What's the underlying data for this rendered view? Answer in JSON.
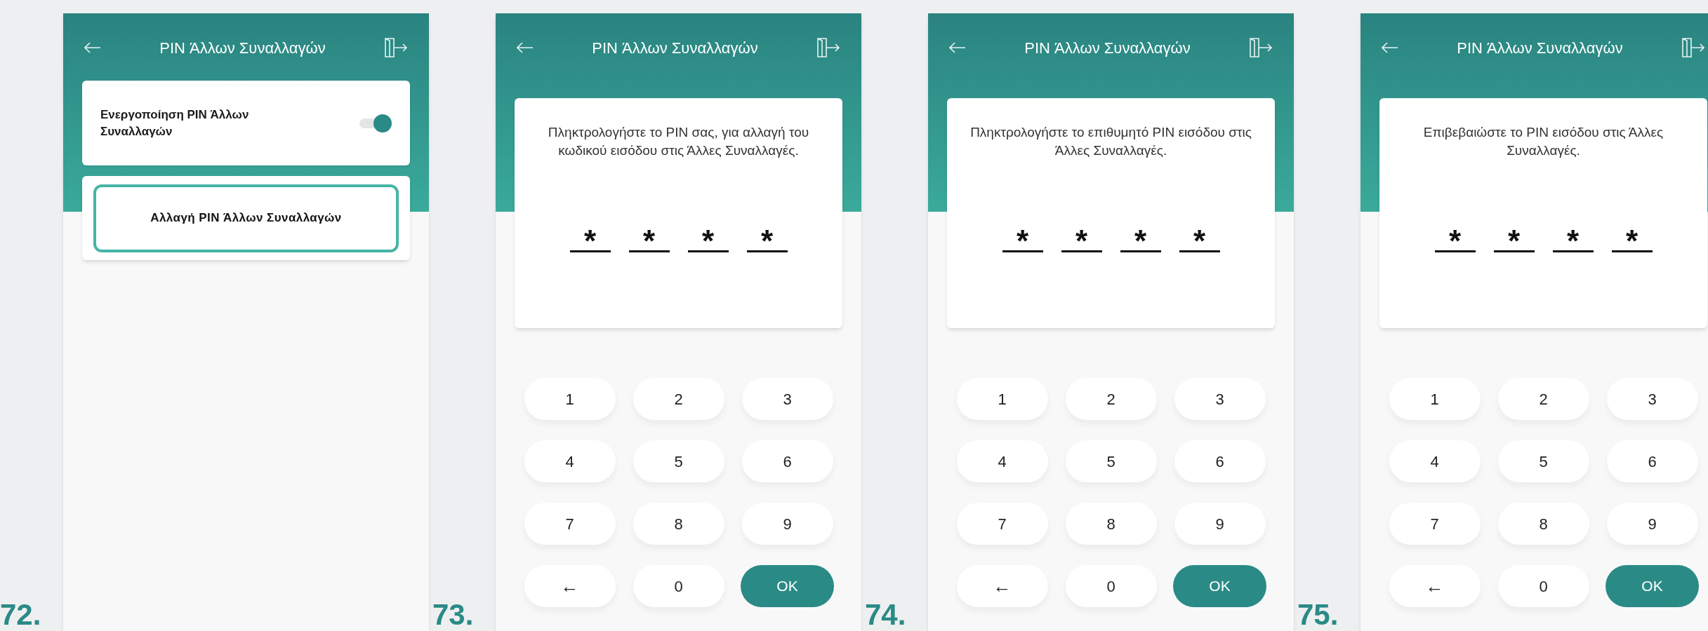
{
  "steps": [
    {
      "number": "72.",
      "screen": {
        "kind": "settings",
        "header": {
          "title": "PIN Άλλων Συναλλαγών"
        },
        "toggle": {
          "label": "Ενεργοποίηση PIN Άλλων Συναλλαγών",
          "on": true
        },
        "action": {
          "label": "Αλλαγή PIN Άλλων Συναλλαγών",
          "highlighted": true
        }
      }
    },
    {
      "number": "73.",
      "screen": {
        "kind": "pin_entry",
        "header": {
          "title": "PIN Άλλων Συναλλαγών"
        },
        "prompt": "Πληκτρολογήστε το PIN σας, για αλλαγή του κωδικού εισόδου στις Άλλες Συναλλαγές.",
        "pin_digits": [
          "*",
          "*",
          "*",
          "*"
        ],
        "keys": [
          {
            "kind": "digit",
            "label": "1"
          },
          {
            "kind": "digit",
            "label": "2"
          },
          {
            "kind": "digit",
            "label": "3"
          },
          {
            "kind": "digit",
            "label": "4"
          },
          {
            "kind": "digit",
            "label": "5"
          },
          {
            "kind": "digit",
            "label": "6"
          },
          {
            "kind": "digit",
            "label": "7"
          },
          {
            "kind": "digit",
            "label": "8"
          },
          {
            "kind": "digit",
            "label": "9"
          },
          {
            "kind": "backspace",
            "label": "←"
          },
          {
            "kind": "digit",
            "label": "0"
          },
          {
            "kind": "ok",
            "label": "OK"
          }
        ]
      }
    },
    {
      "number": "74.",
      "screen": {
        "kind": "pin_entry",
        "header": {
          "title": "PIN Άλλων Συναλλαγών"
        },
        "prompt": "Πληκτρολογήστε το επιθυμητό PIN εισόδου στις Άλλες Συναλλαγές.",
        "pin_digits": [
          "*",
          "*",
          "*",
          "*"
        ],
        "keys": [
          {
            "kind": "digit",
            "label": "1"
          },
          {
            "kind": "digit",
            "label": "2"
          },
          {
            "kind": "digit",
            "label": "3"
          },
          {
            "kind": "digit",
            "label": "4"
          },
          {
            "kind": "digit",
            "label": "5"
          },
          {
            "kind": "digit",
            "label": "6"
          },
          {
            "kind": "digit",
            "label": "7"
          },
          {
            "kind": "digit",
            "label": "8"
          },
          {
            "kind": "digit",
            "label": "9"
          },
          {
            "kind": "backspace",
            "label": "←"
          },
          {
            "kind": "digit",
            "label": "0"
          },
          {
            "kind": "ok",
            "label": "OK"
          }
        ]
      }
    },
    {
      "number": "75.",
      "screen": {
        "kind": "pin_entry",
        "header": {
          "title": "PIN Άλλων Συναλλαγών"
        },
        "prompt": "Επιβεβαιώστε το PIN εισόδου στις Άλλες Συναλλαγές.",
        "pin_digits": [
          "*",
          "*",
          "*",
          "*"
        ],
        "keys": [
          {
            "kind": "digit",
            "label": "1"
          },
          {
            "kind": "digit",
            "label": "2"
          },
          {
            "kind": "digit",
            "label": "3"
          },
          {
            "kind": "digit",
            "label": "4"
          },
          {
            "kind": "digit",
            "label": "5"
          },
          {
            "kind": "digit",
            "label": "6"
          },
          {
            "kind": "digit",
            "label": "7"
          },
          {
            "kind": "digit",
            "label": "8"
          },
          {
            "kind": "digit",
            "label": "9"
          },
          {
            "kind": "backspace",
            "label": "←"
          },
          {
            "kind": "digit",
            "label": "0"
          },
          {
            "kind": "ok",
            "label": "OK"
          }
        ]
      }
    }
  ]
}
